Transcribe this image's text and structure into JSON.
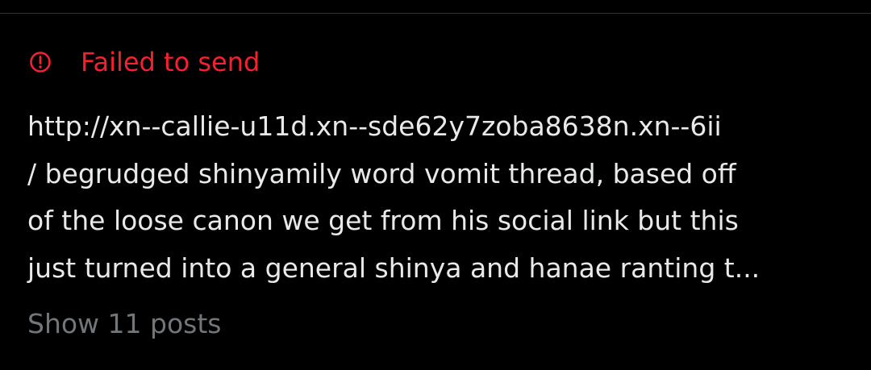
{
  "status": {
    "icon": "alert-circle-icon",
    "text": "Failed to send",
    "color": "#f4212e"
  },
  "post": {
    "lines": [
      "http://xn--callie-u11d.xn--sde62y7zoba8638n.xn--6ii",
      "/ begrudged shinyamily word vomit thread, based off",
      "of the loose canon we get from his social link but this",
      "just turned into a general shinya and hanae ranting t..."
    ]
  },
  "thread": {
    "show_label": "Show 11 posts"
  },
  "colors": {
    "background": "#000000",
    "text": "#e7e9ea",
    "muted": "#71767b",
    "divider": "#2f3336"
  }
}
